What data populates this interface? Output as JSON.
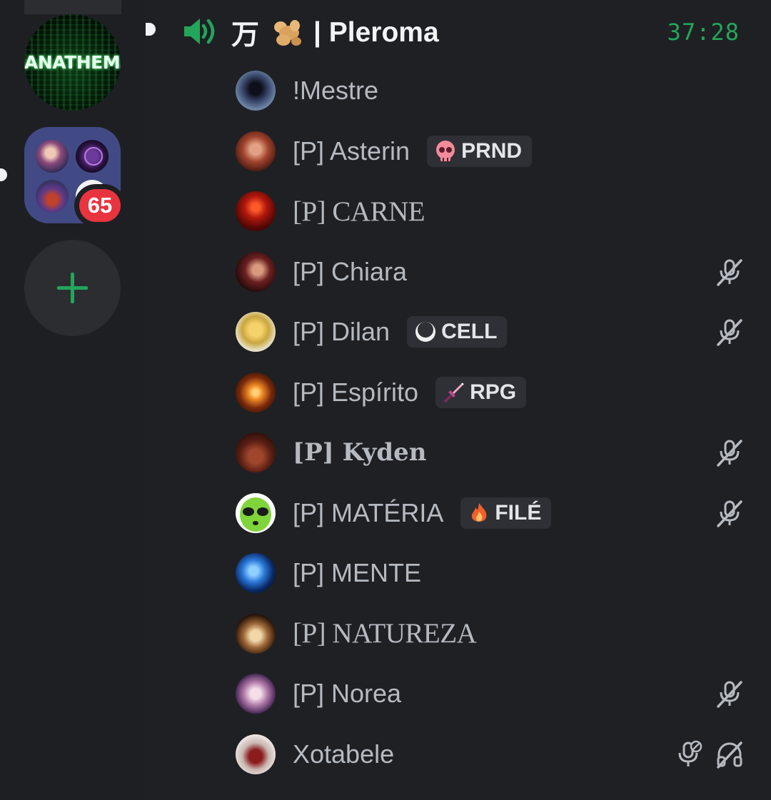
{
  "rail": {
    "servers": [
      {
        "name": "ANATHEMA",
        "logo_text": "ANATHEMA"
      },
      {
        "name": "folder",
        "unread_badge": "65"
      }
    ]
  },
  "voice_channel": {
    "channel_icon": "speaker-icon",
    "name_cjk": "万",
    "name_emoji": "ginger-icon",
    "name_text": "| Pleroma",
    "elapsed": "37:28",
    "accent_color": "#23a55a"
  },
  "members": [
    {
      "name": "!Mestre",
      "tag": null,
      "muted": false,
      "deafened": false
    },
    {
      "name": "[P] Asterin",
      "tag": {
        "icon": "skull-icon",
        "label": "PRND"
      },
      "muted": false,
      "deafened": false
    },
    {
      "name": "[P] CARNE",
      "tag": null,
      "muted": false,
      "deafened": false
    },
    {
      "name": "[P] Chiara",
      "tag": null,
      "muted": true,
      "deafened": false
    },
    {
      "name": "[P] Dilan",
      "tag": {
        "icon": "moon-icon",
        "label": "CELL"
      },
      "muted": true,
      "deafened": false
    },
    {
      "name": "[P] Espírito",
      "tag": {
        "icon": "sword-icon",
        "label": "RPG"
      },
      "muted": false,
      "deafened": false
    },
    {
      "name": "[P] Kyden",
      "tag": null,
      "muted": true,
      "deafened": false
    },
    {
      "name": "[P] MATÉRIA",
      "tag": {
        "icon": "fire-icon",
        "label": "FILÉ"
      },
      "muted": true,
      "deafened": false
    },
    {
      "name": "[P] MENTE",
      "tag": null,
      "muted": false,
      "deafened": false
    },
    {
      "name": "[P] NATUREZA",
      "tag": null,
      "muted": false,
      "deafened": false
    },
    {
      "name": "[P] Norea",
      "tag": null,
      "muted": true,
      "deafened": false
    },
    {
      "name": "Xotabele",
      "tag": null,
      "muted": false,
      "server_muted": true,
      "deafened": true
    }
  ]
}
